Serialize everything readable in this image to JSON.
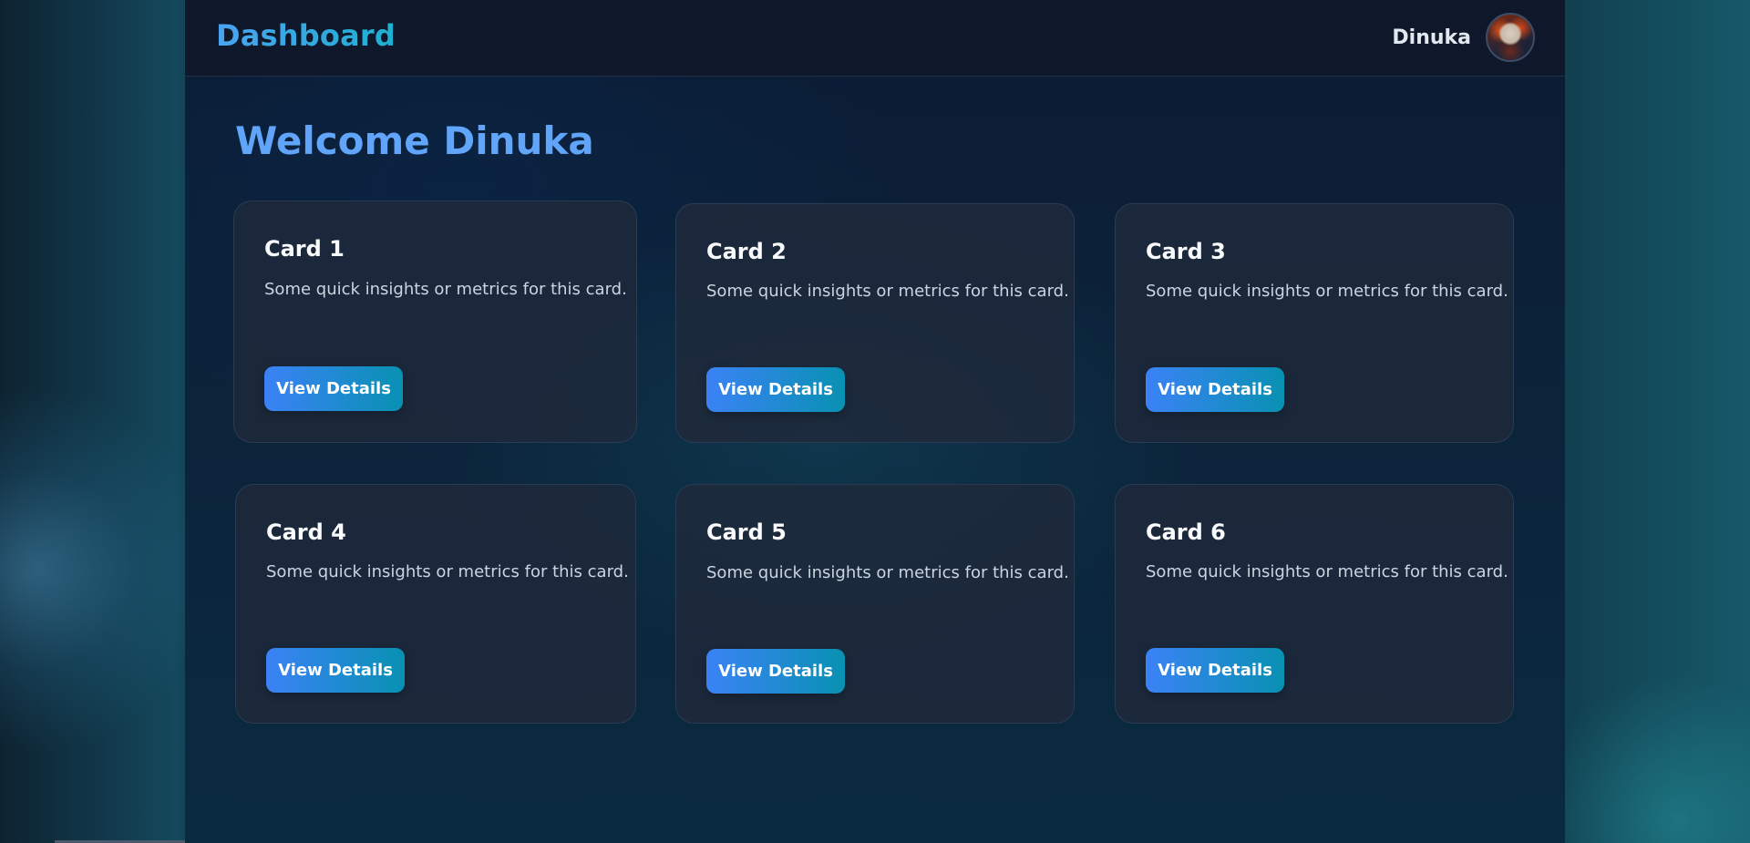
{
  "header": {
    "brand": "Dashboard",
    "user_name": "Dinuka"
  },
  "main": {
    "welcome": "Welcome Dinuka"
  },
  "cards": [
    {
      "title": "Card 1",
      "text": "Some quick insights or metrics for this card.",
      "button": "View Details"
    },
    {
      "title": "Card 2",
      "text": "Some quick insights or metrics for this card.",
      "button": "View Details"
    },
    {
      "title": "Card 3",
      "text": "Some quick insights or metrics for this card.",
      "button": "View Details"
    },
    {
      "title": "Card 4",
      "text": "Some quick insights or metrics for this card.",
      "button": "View Details"
    },
    {
      "title": "Card 5",
      "text": "Some quick insights or metrics for this card.",
      "button": "View Details"
    },
    {
      "title": "Card 6",
      "text": "Some quick insights or metrics for this card.",
      "button": "View Details"
    }
  ],
  "colors": {
    "brand_accent": "#38bdf8",
    "welcome_text": "#60a5fa",
    "button_gradient_start": "#3b82f6",
    "button_gradient_end": "#0891b2",
    "card_background": "#1e293b",
    "topbar_background": "#0f172a"
  }
}
